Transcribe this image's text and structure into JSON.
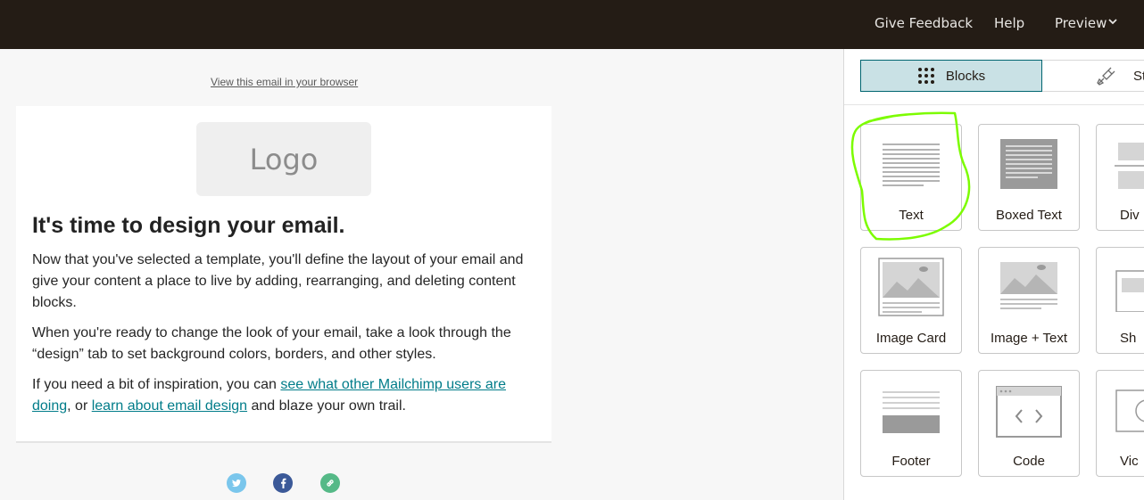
{
  "topbar": {
    "give_feedback": "Give Feedback",
    "help": "Help",
    "preview": "Preview"
  },
  "canvas": {
    "view_in_browser": "View this email in your browser",
    "logo_text": "Logo",
    "headline": "It's time to design your email.",
    "paragraph1": "Now that you've selected a template, you'll define the layout of your email and give your content a place to live by adding, rearranging, and deleting content blocks.",
    "paragraph2": "When you're ready to change the look of your email, take a look through the “design” tab to set background colors, borders, and other styles.",
    "paragraph3": {
      "before": "If you need a bit of inspiration, you can ",
      "link1": "see what other Mailchimp users are doing",
      "middle": ", or ",
      "link2": "learn about email design",
      "after": " and blaze your own trail."
    },
    "social_icons": [
      "twitter-icon",
      "facebook-icon",
      "link-icon"
    ]
  },
  "panel": {
    "tabs": [
      {
        "label": "Blocks",
        "icon": "grid-icon",
        "active": true
      },
      {
        "label": "Sty",
        "icon": "paint-brush-icon",
        "active": false
      }
    ],
    "blocks": [
      {
        "label": "Text",
        "icon": "text-block-icon",
        "highlighted": true
      },
      {
        "label": "Boxed Text",
        "icon": "boxed-text-icon"
      },
      {
        "label": "Div",
        "icon": "divider-icon"
      },
      {
        "label": "Image Card",
        "icon": "image-card-icon"
      },
      {
        "label": "Image + Text",
        "icon": "image-text-icon"
      },
      {
        "label": "Sh",
        "icon": "share-icon"
      },
      {
        "label": "Footer",
        "icon": "footer-icon"
      },
      {
        "label": "Code",
        "icon": "code-icon"
      },
      {
        "label": "Vic",
        "icon": "video-icon"
      }
    ]
  },
  "colors": {
    "topbar_bg": "#241c15",
    "accent_link": "#007c89",
    "active_tab_bg": "#c9e1e5",
    "highlight_stroke": "#7cfc00"
  }
}
